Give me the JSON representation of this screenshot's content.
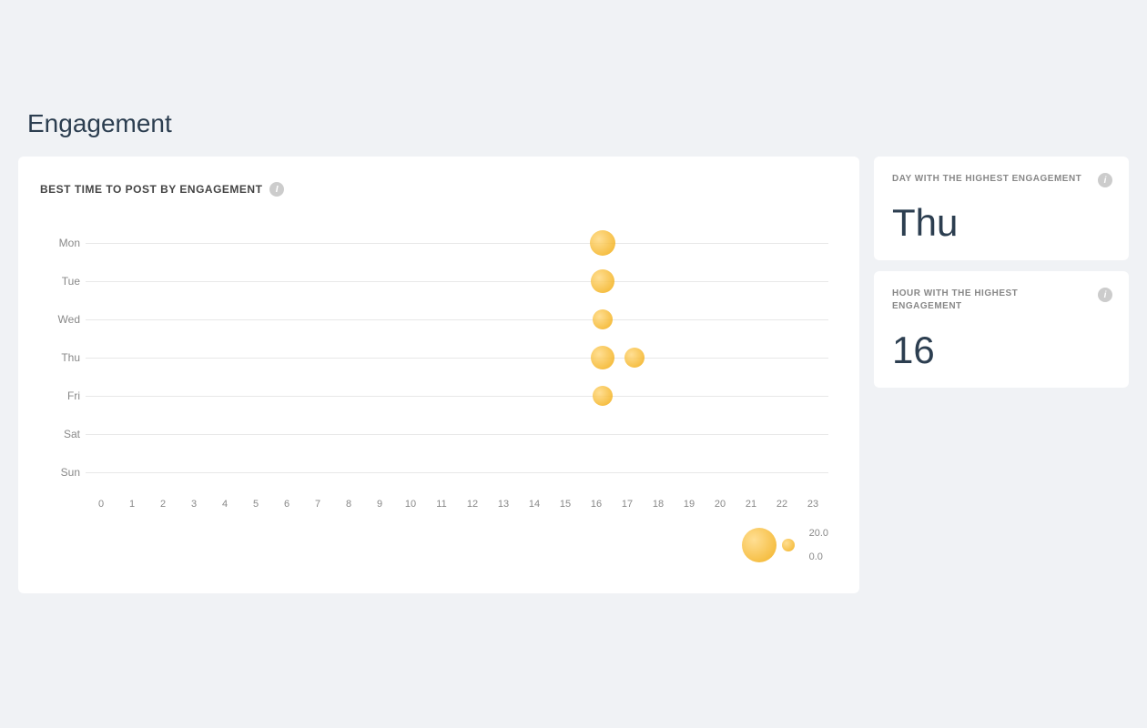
{
  "page": {
    "title": "Engagement"
  },
  "chart": {
    "title": "BEST TIME TO POST BY ENGAGEMENT",
    "info_icon": "i",
    "rows": [
      {
        "label": "Mon",
        "bubbles": [
          {
            "hour": 16,
            "size": 28
          }
        ]
      },
      {
        "label": "Tue",
        "bubbles": [
          {
            "hour": 16,
            "size": 26
          }
        ]
      },
      {
        "label": "Wed",
        "bubbles": [
          {
            "hour": 16,
            "size": 22
          }
        ]
      },
      {
        "label": "Thu",
        "bubbles": [
          {
            "hour": 16,
            "size": 26
          },
          {
            "hour": 17,
            "size": 22
          }
        ]
      },
      {
        "label": "Fri",
        "bubbles": [
          {
            "hour": 16,
            "size": 22
          }
        ]
      },
      {
        "label": "Sat",
        "bubbles": []
      },
      {
        "label": "Sun",
        "bubbles": []
      }
    ],
    "x_labels": [
      "0",
      "1",
      "2",
      "3",
      "4",
      "5",
      "6",
      "7",
      "8",
      "9",
      "10",
      "11",
      "12",
      "13",
      "14",
      "15",
      "16",
      "17",
      "18",
      "19",
      "20",
      "21",
      "22",
      "23"
    ],
    "legend": {
      "max_label": "20.0",
      "min_label": "0.0"
    }
  },
  "sidebar": {
    "day_card": {
      "title": "DAY WITH THE HIGHEST\nENGAGEMENT",
      "value": "Thu"
    },
    "hour_card": {
      "title": "HOUR WITH THE HIGHEST\nENGAGEMENT",
      "value": "16"
    }
  }
}
